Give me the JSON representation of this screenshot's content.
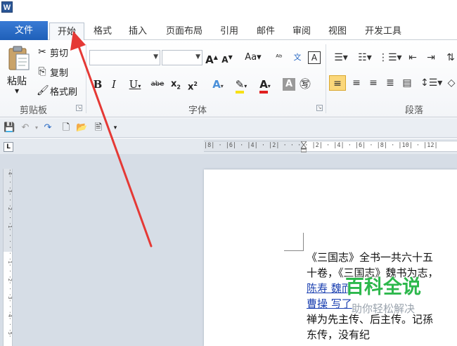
{
  "app": {
    "logo_letter": "W"
  },
  "tabs": {
    "file": "文件",
    "home": "开始",
    "items": [
      "格式",
      "插入",
      "页面布局",
      "引用",
      "邮件",
      "审阅",
      "视图",
      "开发工具"
    ]
  },
  "ribbon": {
    "clipboard": {
      "paste": "粘贴",
      "cut": "剪切",
      "copy": "复制",
      "format_painter": "格式刷",
      "group_label": "剪贴板"
    },
    "font": {
      "group_label": "字体"
    },
    "paragraph": {
      "group_label": "段落"
    }
  },
  "document": {
    "lines": [
      "《三国志》全书一共六十五",
      "十卷，《三国志》魏书为志，",
      "陈寿        魏而",
      "曹操        写了",
      "禅为先主传、后主传。记孫",
      "东传，没有纪"
    ]
  },
  "watermark": {
    "title": "百科全说",
    "subtitle": "助你轻松解决"
  },
  "colors": {
    "file_tab": "#2b6bc4",
    "arrow": "#e53935",
    "watermark_green": "#2db84c",
    "link": "#1a3fb0"
  }
}
